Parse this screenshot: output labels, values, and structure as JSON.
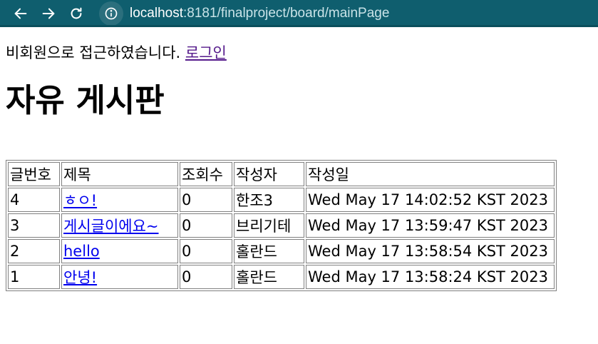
{
  "browser": {
    "url_host": "localhost",
    "url_rest": ":8181/finalproject/board/mainPage"
  },
  "page": {
    "notice_text": "비회원으로 접근하였습니다.",
    "login_link": "로그인",
    "title": "자유 게시판"
  },
  "table": {
    "headers": [
      "글번호",
      "제목",
      "조회수",
      "작성자",
      "작성일"
    ],
    "rows": [
      {
        "no": "4",
        "title": "ㅎㅇ!",
        "views": "0",
        "author": "한조3",
        "date": "Wed May 17 14:02:52 KST 2023"
      },
      {
        "no": "3",
        "title": "게시글이에요~",
        "views": "0",
        "author": "브리기테",
        "date": "Wed May 17 13:59:47 KST 2023"
      },
      {
        "no": "2",
        "title": "hello",
        "views": "0",
        "author": "홀란드",
        "date": "Wed May 17 13:58:54 KST 2023"
      },
      {
        "no": "1",
        "title": "안녕!",
        "views": "0",
        "author": "홀란드",
        "date": "Wed May 17 13:58:24 KST 2023"
      }
    ]
  }
}
